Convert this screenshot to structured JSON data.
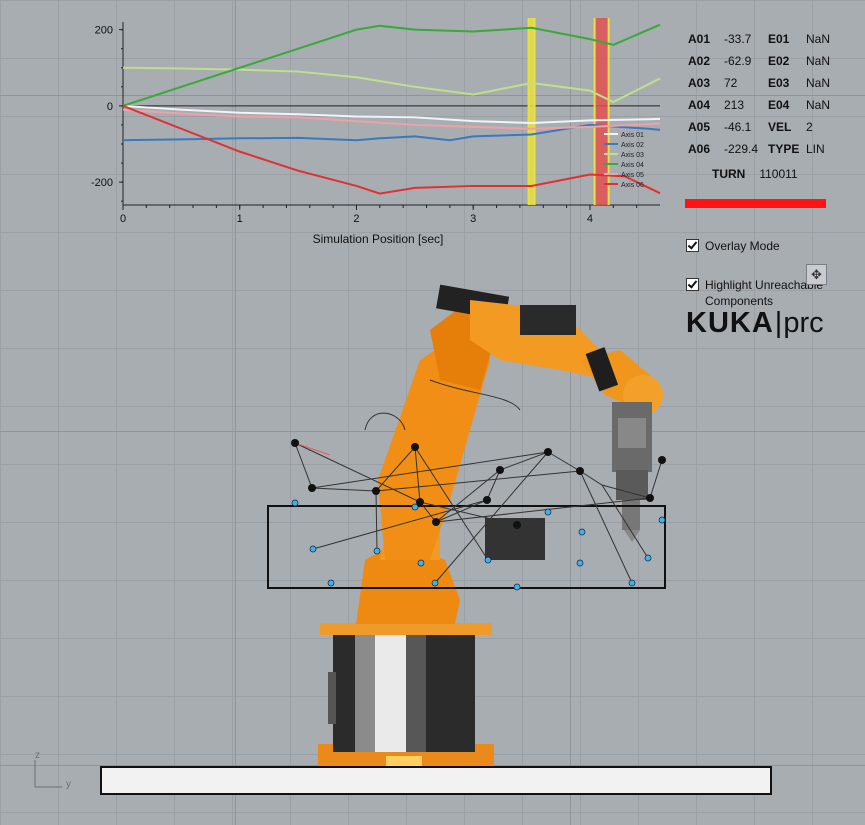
{
  "chart_data": {
    "type": "line",
    "xlabel": "Simulation Position [sec]",
    "xlim": [
      0,
      4.6
    ],
    "ylim": [
      -260,
      220
    ],
    "xticks": [
      0,
      1,
      2,
      3,
      4
    ],
    "yticks": [
      200,
      0,
      -200
    ],
    "series": [
      {
        "name": "Axis 01",
        "color": "#f0f4f8",
        "x": [
          0,
          0.5,
          1,
          1.5,
          2,
          2.5,
          3,
          3.5,
          4,
          4.5,
          4.6
        ],
        "y": [
          0,
          -10,
          -18,
          -22,
          -28,
          -30,
          -40,
          -45,
          -38,
          -35,
          -34
        ]
      },
      {
        "name": "Axis 02",
        "color": "#3a78c0",
        "x": [
          0,
          0.5,
          1,
          1.5,
          2,
          2.2,
          2.5,
          2.8,
          3,
          3.5,
          4,
          4.5,
          4.6
        ],
        "y": [
          -90,
          -88,
          -85,
          -84,
          -90,
          -85,
          -80,
          -90,
          -80,
          -75,
          -50,
          -60,
          -63
        ]
      },
      {
        "name": "Axis 03",
        "color": "#bfe08a",
        "x": [
          0,
          0.5,
          1,
          1.5,
          2,
          2.3,
          2.5,
          3,
          3.5,
          4,
          4.2,
          4.6
        ],
        "y": [
          100,
          98,
          95,
          90,
          75,
          60,
          50,
          30,
          60,
          40,
          10,
          72
        ]
      },
      {
        "name": "Axis 04",
        "color": "#3aa83a",
        "x": [
          0,
          0.5,
          1,
          1.5,
          2,
          2.2,
          2.5,
          3,
          3.5,
          4,
          4.2,
          4.6
        ],
        "y": [
          0,
          50,
          100,
          150,
          200,
          210,
          200,
          195,
          205,
          175,
          160,
          213
        ]
      },
      {
        "name": "Axis 05",
        "color": "#f0a0a8",
        "x": [
          0,
          0.5,
          1,
          1.5,
          2,
          2.5,
          3,
          3.5,
          4,
          4.5,
          4.6
        ],
        "y": [
          -10,
          -20,
          -28,
          -30,
          -40,
          -50,
          -55,
          -60,
          -55,
          -48,
          -46
        ]
      },
      {
        "name": "Axis 06",
        "color": "#e03030",
        "x": [
          0,
          0.5,
          1,
          1.5,
          2,
          2.2,
          2.5,
          3,
          3.5,
          4,
          4.3,
          4.6
        ],
        "y": [
          0,
          -60,
          -120,
          -170,
          -210,
          -230,
          -215,
          -210,
          -210,
          -180,
          -185,
          -229
        ]
      }
    ],
    "highlights": [
      {
        "x": 3.5,
        "color": "#e8e040"
      },
      {
        "x": 4.1,
        "color": "#e05050"
      }
    ]
  },
  "values": {
    "rows": [
      {
        "k": "A01",
        "v": "-33.7",
        "k2": "E01",
        "v2": "NaN"
      },
      {
        "k": "A02",
        "v": "-62.9",
        "k2": "E02",
        "v2": "NaN"
      },
      {
        "k": "A03",
        "v": "72",
        "k2": "E03",
        "v2": "NaN"
      },
      {
        "k": "A04",
        "v": "213",
        "k2": "E04",
        "v2": "NaN"
      },
      {
        "k": "A05",
        "v": "-46.1",
        "k2": "VEL",
        "v2": "2"
      },
      {
        "k": "A06",
        "v": "-229.4",
        "k2": "TYPE",
        "v2": "LIN"
      }
    ],
    "turn_label": "TURN",
    "turn_value": "110011"
  },
  "options": {
    "overlay_label": "Overlay Mode",
    "highlight_label": "Highlight Unreachable Components"
  },
  "logo": {
    "bold": "KUKA",
    "sep": "|",
    "light": "prc"
  },
  "axis_indicator": {
    "z": "z",
    "y": "y"
  }
}
